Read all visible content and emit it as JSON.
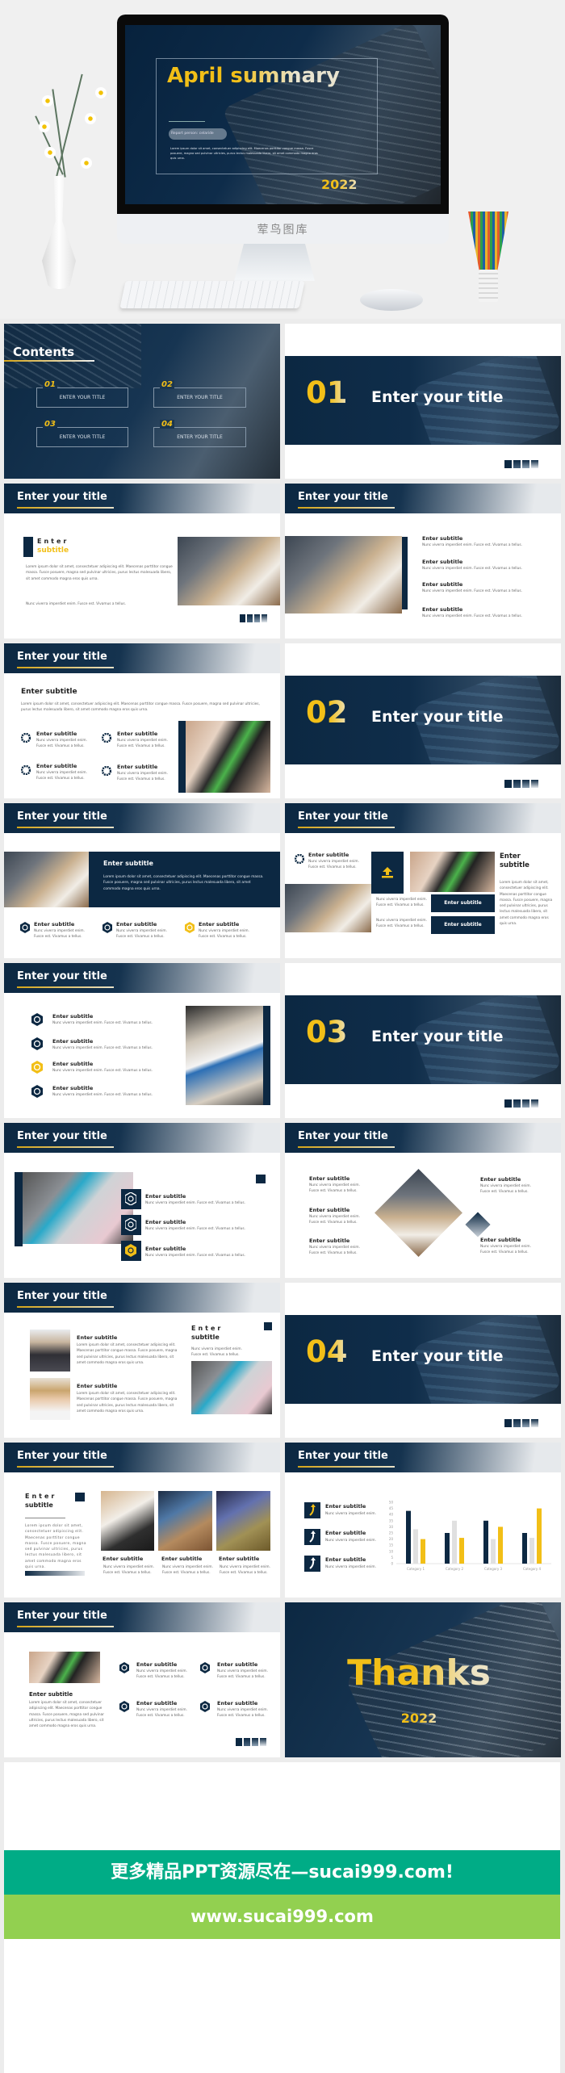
{
  "hero": {
    "title": "April summary",
    "pill": "Report person: celaride",
    "body": "Lorem ipsum dolor sit amet, consectetuer adipiscing elit. Maecenas porttitor congue massa. Fusce posuere, magna sed pulvinar ultricies, purus lectus malesuada libero, sit amet commodo magna eros quis urna.",
    "year": "2022",
    "watermark": "荤鸟图库"
  },
  "text": {
    "lorem": "Lorem ipsum dolor sit amet, consectetuer adipiscing elit. Maecenas porttitor congue massa. Fusce posuere, magna sed pulvinar ultricies, purus lectus malesuada libero, sit amet commodo magna eros quis urna.",
    "nunc": "Nunc viverra imperdiet enim. Fusce est. Vivamus a tellus.",
    "nunc_short": "Nunc viverra imperdiet enim.",
    "enter": "Enter",
    "subtitle_word": "subtitle",
    "subtitle": "Enter subtitle",
    "slide_title": "Enter your title"
  },
  "contents": {
    "heading": "Contents",
    "items": [
      {
        "num": "01",
        "label": "ENTER YOUR TITLE"
      },
      {
        "num": "02",
        "label": "ENTER YOUR TITLE"
      },
      {
        "num": "03",
        "label": "ENTER YOUR TITLE"
      },
      {
        "num": "04",
        "label": "ENTER YOUR TITLE"
      }
    ]
  },
  "sections": [
    {
      "num": "01",
      "title": "Enter your title"
    },
    {
      "num": "02",
      "title": "Enter your title"
    },
    {
      "num": "03",
      "title": "Enter your title"
    },
    {
      "num": "04",
      "title": "Enter your title"
    }
  ],
  "thanks": {
    "title": "Thanks",
    "year": "2022"
  },
  "colors": {
    "navy": "#0c2842",
    "accent": "#f2bf17",
    "banner_green": "#00ac86",
    "banner_lime": "#92d050"
  },
  "chart_data": {
    "type": "bar",
    "categories": [
      "Category 1",
      "Category 2",
      "Category 3",
      "Category 4"
    ],
    "series": [
      {
        "color": "#0c2842",
        "values": [
          43,
          25,
          35,
          25
        ]
      },
      {
        "color": "#e0e0e0",
        "values": [
          28,
          35,
          20,
          21
        ]
      },
      {
        "color": "#f2bf17",
        "values": [
          20,
          21,
          30,
          45
        ]
      }
    ],
    "ylim": [
      0,
      50
    ],
    "yticks": [
      0,
      5,
      10,
      15,
      20,
      25,
      30,
      35,
      40,
      45,
      50
    ],
    "grid": false
  },
  "banner": {
    "line1": "更多精品PPT资源尽在—sucai999.com!",
    "line2": "www.sucai999.com"
  }
}
